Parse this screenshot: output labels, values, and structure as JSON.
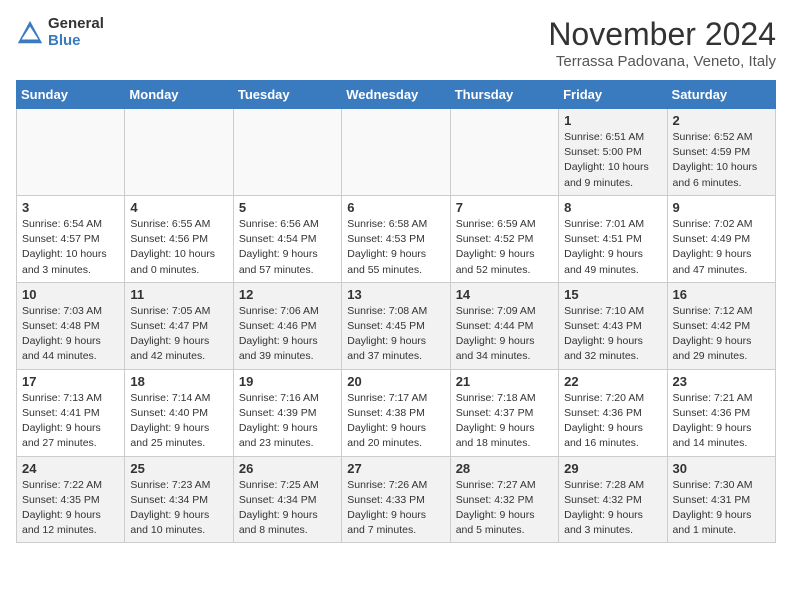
{
  "logo": {
    "general": "General",
    "blue": "Blue"
  },
  "header": {
    "month": "November 2024",
    "location": "Terrassa Padovana, Veneto, Italy"
  },
  "columns": [
    "Sunday",
    "Monday",
    "Tuesday",
    "Wednesday",
    "Thursday",
    "Friday",
    "Saturday"
  ],
  "weeks": [
    [
      {
        "day": "",
        "content": ""
      },
      {
        "day": "",
        "content": ""
      },
      {
        "day": "",
        "content": ""
      },
      {
        "day": "",
        "content": ""
      },
      {
        "day": "",
        "content": ""
      },
      {
        "day": "1",
        "content": "Sunrise: 6:51 AM\nSunset: 5:00 PM\nDaylight: 10 hours and 9 minutes."
      },
      {
        "day": "2",
        "content": "Sunrise: 6:52 AM\nSunset: 4:59 PM\nDaylight: 10 hours and 6 minutes."
      }
    ],
    [
      {
        "day": "3",
        "content": "Sunrise: 6:54 AM\nSunset: 4:57 PM\nDaylight: 10 hours and 3 minutes."
      },
      {
        "day": "4",
        "content": "Sunrise: 6:55 AM\nSunset: 4:56 PM\nDaylight: 10 hours and 0 minutes."
      },
      {
        "day": "5",
        "content": "Sunrise: 6:56 AM\nSunset: 4:54 PM\nDaylight: 9 hours and 57 minutes."
      },
      {
        "day": "6",
        "content": "Sunrise: 6:58 AM\nSunset: 4:53 PM\nDaylight: 9 hours and 55 minutes."
      },
      {
        "day": "7",
        "content": "Sunrise: 6:59 AM\nSunset: 4:52 PM\nDaylight: 9 hours and 52 minutes."
      },
      {
        "day": "8",
        "content": "Sunrise: 7:01 AM\nSunset: 4:51 PM\nDaylight: 9 hours and 49 minutes."
      },
      {
        "day": "9",
        "content": "Sunrise: 7:02 AM\nSunset: 4:49 PM\nDaylight: 9 hours and 47 minutes."
      }
    ],
    [
      {
        "day": "10",
        "content": "Sunrise: 7:03 AM\nSunset: 4:48 PM\nDaylight: 9 hours and 44 minutes."
      },
      {
        "day": "11",
        "content": "Sunrise: 7:05 AM\nSunset: 4:47 PM\nDaylight: 9 hours and 42 minutes."
      },
      {
        "day": "12",
        "content": "Sunrise: 7:06 AM\nSunset: 4:46 PM\nDaylight: 9 hours and 39 minutes."
      },
      {
        "day": "13",
        "content": "Sunrise: 7:08 AM\nSunset: 4:45 PM\nDaylight: 9 hours and 37 minutes."
      },
      {
        "day": "14",
        "content": "Sunrise: 7:09 AM\nSunset: 4:44 PM\nDaylight: 9 hours and 34 minutes."
      },
      {
        "day": "15",
        "content": "Sunrise: 7:10 AM\nSunset: 4:43 PM\nDaylight: 9 hours and 32 minutes."
      },
      {
        "day": "16",
        "content": "Sunrise: 7:12 AM\nSunset: 4:42 PM\nDaylight: 9 hours and 29 minutes."
      }
    ],
    [
      {
        "day": "17",
        "content": "Sunrise: 7:13 AM\nSunset: 4:41 PM\nDaylight: 9 hours and 27 minutes."
      },
      {
        "day": "18",
        "content": "Sunrise: 7:14 AM\nSunset: 4:40 PM\nDaylight: 9 hours and 25 minutes."
      },
      {
        "day": "19",
        "content": "Sunrise: 7:16 AM\nSunset: 4:39 PM\nDaylight: 9 hours and 23 minutes."
      },
      {
        "day": "20",
        "content": "Sunrise: 7:17 AM\nSunset: 4:38 PM\nDaylight: 9 hours and 20 minutes."
      },
      {
        "day": "21",
        "content": "Sunrise: 7:18 AM\nSunset: 4:37 PM\nDaylight: 9 hours and 18 minutes."
      },
      {
        "day": "22",
        "content": "Sunrise: 7:20 AM\nSunset: 4:36 PM\nDaylight: 9 hours and 16 minutes."
      },
      {
        "day": "23",
        "content": "Sunrise: 7:21 AM\nSunset: 4:36 PM\nDaylight: 9 hours and 14 minutes."
      }
    ],
    [
      {
        "day": "24",
        "content": "Sunrise: 7:22 AM\nSunset: 4:35 PM\nDaylight: 9 hours and 12 minutes."
      },
      {
        "day": "25",
        "content": "Sunrise: 7:23 AM\nSunset: 4:34 PM\nDaylight: 9 hours and 10 minutes."
      },
      {
        "day": "26",
        "content": "Sunrise: 7:25 AM\nSunset: 4:34 PM\nDaylight: 9 hours and 8 minutes."
      },
      {
        "day": "27",
        "content": "Sunrise: 7:26 AM\nSunset: 4:33 PM\nDaylight: 9 hours and 7 minutes."
      },
      {
        "day": "28",
        "content": "Sunrise: 7:27 AM\nSunset: 4:32 PM\nDaylight: 9 hours and 5 minutes."
      },
      {
        "day": "29",
        "content": "Sunrise: 7:28 AM\nSunset: 4:32 PM\nDaylight: 9 hours and 3 minutes."
      },
      {
        "day": "30",
        "content": "Sunrise: 7:30 AM\nSunset: 4:31 PM\nDaylight: 9 hours and 1 minute."
      }
    ]
  ]
}
